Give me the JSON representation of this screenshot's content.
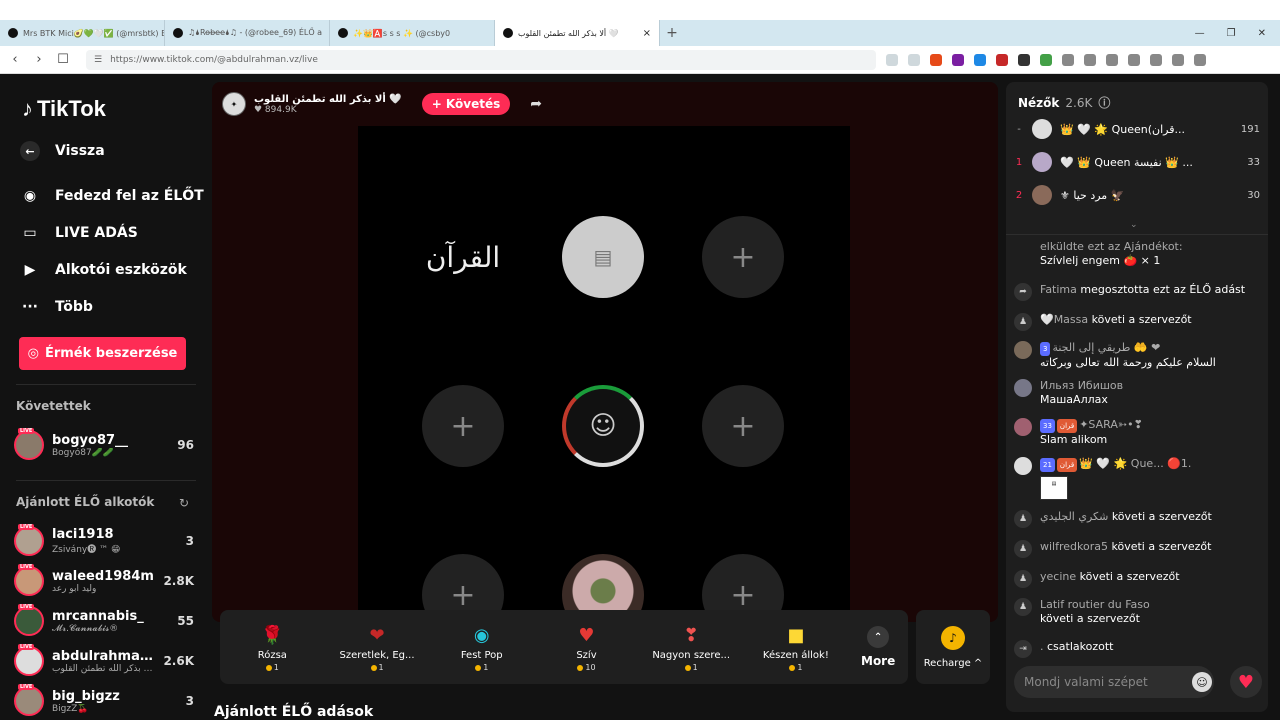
{
  "browser": {
    "tabs": [
      {
        "title": "Mrs BTK Mici🥑💚🤍✅ (@mrsbtk) E",
        "active": false
      },
      {
        "title": "♫🌢Ro̶b̶e̶e̶🌢♫ - (@robee_69) ÉLŐ a",
        "active": false
      },
      {
        "title": "✨👑🅰️ꜱ ꜱ ꜱ ✨ (@csby0",
        "active": false
      },
      {
        "title": "ألا بذكر الله تطمئن القلوب 🤍",
        "active": true
      }
    ],
    "new_tab": "+",
    "url": "https://www.tiktok.com/@abdulrahman.vz/live"
  },
  "sidebar": {
    "logo": "TikTok",
    "nav": [
      {
        "label": "Vissza",
        "icon": "back-arrow-icon"
      },
      {
        "label": "Fedezd fel az ÉLŐT",
        "icon": "explore-live-icon"
      },
      {
        "label": "LIVE ADÁS",
        "icon": "video-camera-icon"
      },
      {
        "label": "Alkotói eszközök",
        "icon": "creator-tools-icon"
      },
      {
        "label": "Több",
        "icon": "more-dots-icon"
      }
    ],
    "coins_button": "Érmék beszerzése",
    "following_title": "Követettek",
    "following": [
      {
        "name": "bogyo87__",
        "sub": "Bogyó87🥒🥒",
        "count": "96"
      }
    ],
    "recommended_title": "Ajánlott ÉLŐ alkotók",
    "recommended": [
      {
        "name": "laci1918",
        "sub": "Zsivány🅡 ™ 😁",
        "count": "3"
      },
      {
        "name": "waleed1984m",
        "sub": "وليد ابو رعد",
        "count": "2.8K"
      },
      {
        "name": "mrcannabis_",
        "sub": "𝓜𝓻.𝓒𝓪𝓷𝓷𝓪𝓫𝓲𝓼®",
        "count": "55"
      },
      {
        "name": "abdulrahman...",
        "sub": "ألا بذكر الله تطمئن القلوب ...",
        "count": "2.6K"
      },
      {
        "name": "big_bigzz",
        "sub": "BigzZ🍒",
        "count": "3"
      }
    ]
  },
  "stream": {
    "host_name": "ألا بذكر الله تطمئن القلوب 🤍",
    "host_likes": "♥ 894.9K",
    "follow_label": "+ Követés",
    "plus": "+",
    "calligraphy": "القرآن"
  },
  "gifts": [
    {
      "name": "Rózsa",
      "price": "1",
      "icon": "🌹"
    },
    {
      "name": "Szeretlek, Eg...",
      "price": "1",
      "icon": "❤"
    },
    {
      "name": "Fest Pop",
      "price": "1",
      "icon": "◉"
    },
    {
      "name": "Szív",
      "price": "10",
      "icon": "♥"
    },
    {
      "name": "Nagyon szere...",
      "price": "1",
      "icon": "❣"
    },
    {
      "name": "Készen állok!",
      "price": "1",
      "icon": "■"
    }
  ],
  "gift_more": "More",
  "recharge": "Recharge ^",
  "recommended_lives_title": "Ajánlott ÉLŐ adások",
  "chat": {
    "viewers_label": "Nézők",
    "viewers_count": "2.6K",
    "top_viewers": [
      {
        "rank": "-",
        "name": "👑 🤍 🌟 Queen(قران...",
        "score": "191"
      },
      {
        "rank": "1",
        "name": "🤍 👑 Queen نفيسة 👑 ...",
        "score": "33"
      },
      {
        "rank": "2",
        "name": "⚜ مرد حيا 🦅",
        "score": "30"
      }
    ],
    "messages": [
      {
        "type": "gift",
        "name": "elküldte ezt az Ajándékot:",
        "text": "Szívlelj engem 🍅 × 1"
      },
      {
        "type": "share",
        "name": "Fatima",
        "text": "megosztotta ezt az ÉLŐ adást"
      },
      {
        "type": "follow",
        "name": "🤍Massa",
        "text": "követi a szervezőt"
      },
      {
        "type": "comment",
        "badge": "3",
        "name": "طريقي إلى الجنة 🤲 ❤",
        "text": "السلام عليكم ورحمة الله تعالى وبركاته"
      },
      {
        "type": "comment",
        "name": "Ильяз Ибишов",
        "text": "МашаАллах"
      },
      {
        "type": "comment",
        "badge": "33",
        "badge2": "قران",
        "name": "✦SARA➳•❣",
        "text": "Slam alikom"
      },
      {
        "type": "gift",
        "badge": "21",
        "badge2": "قران",
        "name": "👑 🤍 🌟 Que... 🔴1.",
        "text": ""
      },
      {
        "type": "follow",
        "name": "شكري الجليدي",
        "text": "követi a szervezőt"
      },
      {
        "type": "follow",
        "name": "wilfredkora5",
        "text": "követi a szervezőt"
      },
      {
        "type": "follow",
        "name": "yecine",
        "text": "követi a szervezőt"
      },
      {
        "type": "follow",
        "name": "Latif routier du Faso",
        "text": "követi a szervezőt"
      },
      {
        "type": "join",
        "name": ".",
        "text": "csatlakozott"
      }
    ],
    "input_placeholder": "Mondj valami szépet"
  }
}
